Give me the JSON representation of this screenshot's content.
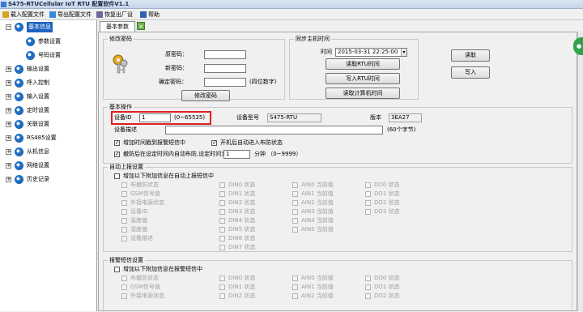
{
  "window": {
    "title": "S475-RTUCellular IoT RTU 配置软件V1.1"
  },
  "menu": {
    "import": "载入配置文件",
    "export": "导出配置文件",
    "restore": "恢复出厂设置",
    "help": "帮助"
  },
  "tree": {
    "nodes": [
      {
        "label": "基本信息",
        "selected": true,
        "expanded": true
      },
      {
        "label": "参数设置",
        "child": true
      },
      {
        "label": "号码设置",
        "child": true
      },
      {
        "label": "输出设置"
      },
      {
        "label": "呼入控制"
      },
      {
        "label": "输入设置"
      },
      {
        "label": "定时设置"
      },
      {
        "label": "关联设置"
      },
      {
        "label": "RS485设置"
      },
      {
        "label": "从机信息"
      },
      {
        "label": "网络设置"
      },
      {
        "label": "历史记录"
      }
    ]
  },
  "tab": {
    "label": "基本参数",
    "close": "✕"
  },
  "password": {
    "group": "修改密码",
    "old_label": "原密码：",
    "new_label": "新密码：",
    "confirm_label": "确定密码：",
    "hint": "(四位数字)",
    "button": "修改密码"
  },
  "sync": {
    "group": "同步主机时间",
    "time_label": "时间",
    "time_value": "2015-03-31 22:25:00",
    "read_rtu": "读取RTU时间",
    "write_rtu": "写入RTU时间",
    "read_pc": "读取计算机时间"
  },
  "actions": {
    "read": "读取",
    "write": "写入"
  },
  "basic": {
    "group": "基本操作",
    "device_id_label": "设备ID",
    "device_id_value": "1",
    "device_id_range": "(0~65535)",
    "model_label": "设备型号",
    "model_value": "S475-RTU",
    "version_label": "版本",
    "version_value": "3EA27",
    "desc_label": "设备描述",
    "desc_value": "",
    "desc_hint": "(60个字节)",
    "opt_timestamp": "增加时间戳到报警短信中",
    "opt_autoarm": "开机后自动进入布防状态",
    "opt_disarm": "撤防后在设定时间内自动布防,设定时间为：",
    "disarm_value": "1",
    "disarm_unit": "分钟 （0~9999）"
  },
  "auto_report": {
    "group": "自动上报设置",
    "enable": "增加以下附加信息在自动上报短信中",
    "col1": [
      "布撤防状态",
      "GSM信号值",
      "外接电源状态",
      "设备ID",
      "温度值",
      "湿度值",
      "设备描述"
    ],
    "col2": [
      "DIN0 状态",
      "DIN1 状态",
      "DIN2 状态",
      "DIN3 状态",
      "DIN4 状态",
      "DIN5 状态",
      "DIN6 状态",
      "DIN7 状态"
    ],
    "col3": [
      "AIN0 当前值",
      "AIN1 当前值",
      "AIN2 当前值",
      "AIN3 当前值",
      "AIN4 当前值",
      "AIN5 当前值"
    ],
    "col4": [
      "DO0 状态",
      "DO1 状态",
      "DO2 状态",
      "DO3 状态"
    ]
  },
  "alarm": {
    "group": "报警短信设置",
    "enable": "增加以下附加信息在报警短信中",
    "col1": [
      "布撤防状态",
      "GSM信号值",
      "外接电源状态"
    ],
    "col2": [
      "DIN0 状态",
      "DIN1 状态",
      "DIN2 状态"
    ],
    "col3": [
      "AIN0 当前值",
      "AIN1 当前值",
      "AIN2 当前值"
    ],
    "col4": [
      "DO0 状态",
      "DO1 状态",
      "DO2 状态"
    ]
  }
}
